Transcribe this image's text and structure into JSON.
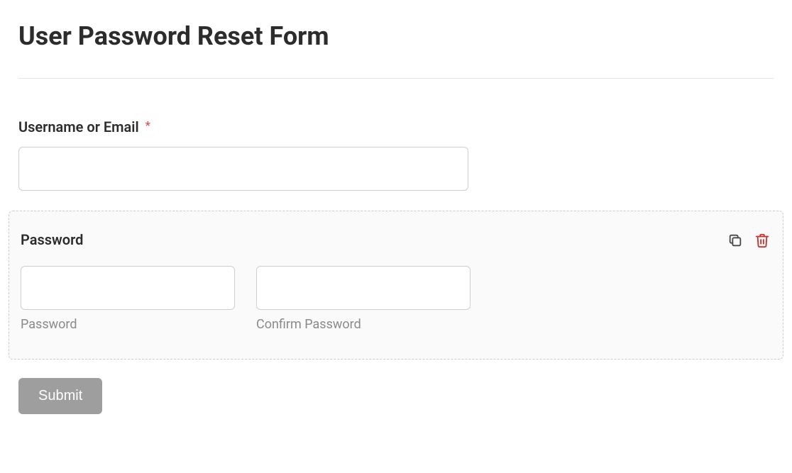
{
  "page": {
    "title": "User Password Reset Form"
  },
  "fields": {
    "username": {
      "label": "Username or Email",
      "required_marker": "*",
      "value": ""
    },
    "password_block": {
      "title": "Password",
      "password": {
        "value": "",
        "sub_label": "Password"
      },
      "confirm": {
        "value": "",
        "sub_label": "Confirm Password"
      }
    }
  },
  "actions": {
    "submit_label": "Submit"
  },
  "colors": {
    "required": "#d9534f",
    "delete_icon": "#c9302c",
    "copy_icon": "#4a4a4a",
    "submit_bg": "#9e9e9e"
  }
}
